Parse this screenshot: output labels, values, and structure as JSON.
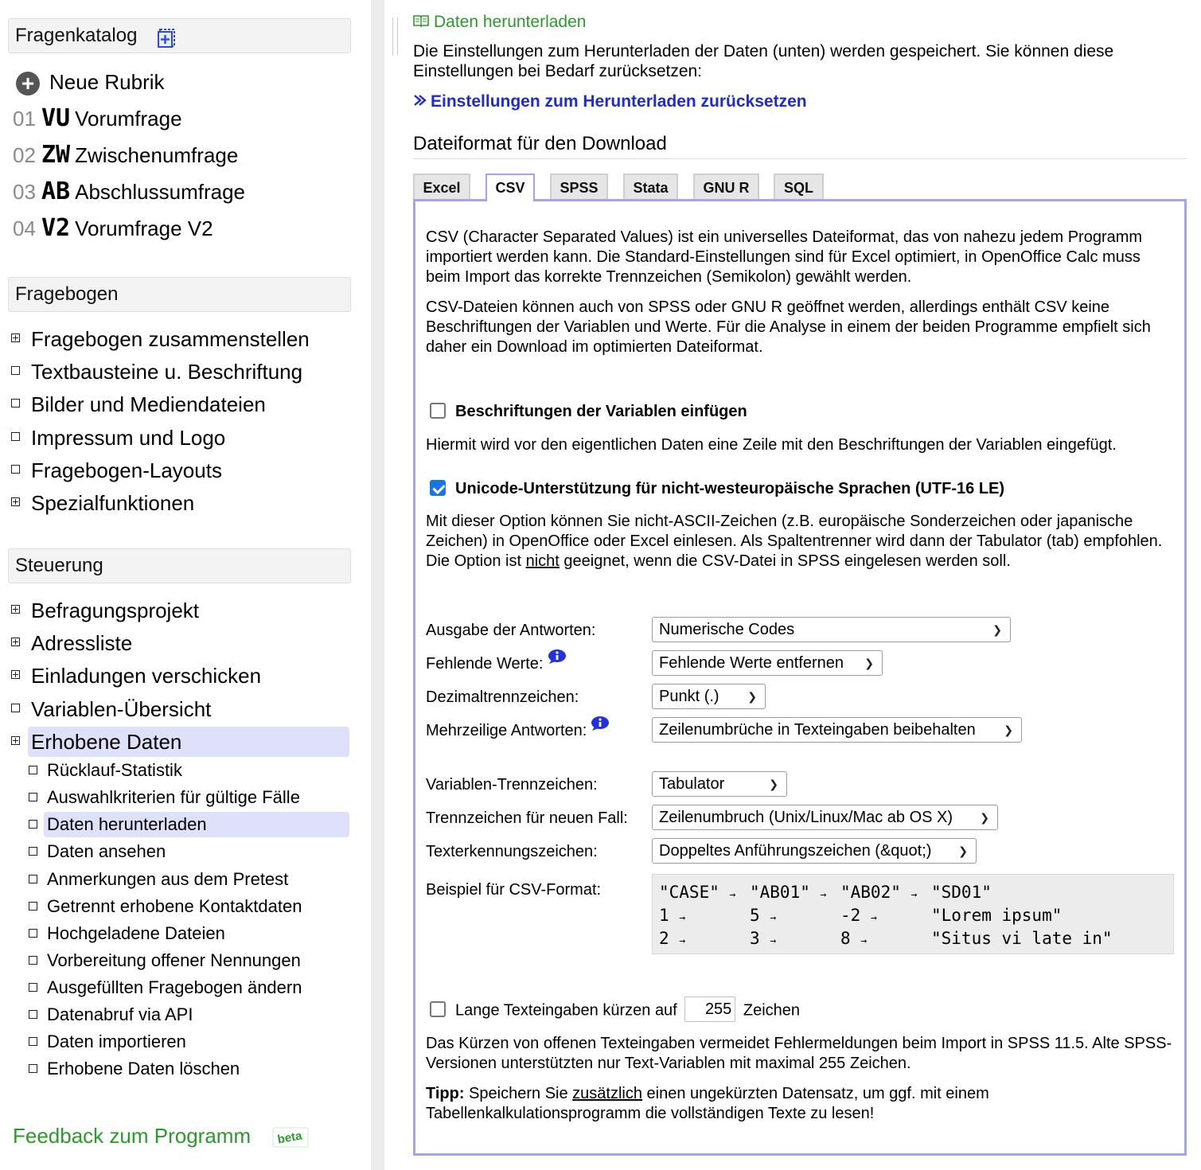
{
  "sidebar": {
    "catalog_title": "Fragenkatalog",
    "new_section": "Neue Rubrik",
    "sections": [
      {
        "num": "01",
        "code": "VU",
        "name": "Vorumfrage"
      },
      {
        "num": "02",
        "code": "ZW",
        "name": "Zwischenumfrage"
      },
      {
        "num": "03",
        "code": "AB",
        "name": "Abschlussumfrage"
      },
      {
        "num": "04",
        "code": "V2",
        "name": "Vorumfrage V2"
      }
    ],
    "questionnaire_title": "Fragebogen",
    "questionnaire_items": [
      "Fragebogen zusammenstellen",
      "Textbausteine u. Beschriftung",
      "Bilder und Mediendateien",
      "Impressum und Logo",
      "Fragebogen-Layouts",
      "Spezialfunktionen"
    ],
    "control_title": "Steuerung",
    "control_items": [
      "Befragungsprojekt",
      "Adressliste",
      "Einladungen verschicken",
      "Variablen-Übersicht",
      "Erhobene Daten"
    ],
    "data_items": [
      "Rücklauf-Statistik",
      "Auswahlkriterien für gültige Fälle",
      "Daten herunterladen",
      "Daten ansehen",
      "Anmerkungen aus dem Pretest",
      "Getrennt erhobene Kontaktdaten",
      "Hochgeladene Dateien",
      "Vorbereitung offener Nennungen",
      "Ausgefüllten Fragebogen ändern",
      "Datenabruf via API",
      "Daten importieren",
      "Erhobene Daten löschen"
    ],
    "feedback": "Feedback zum Programm",
    "beta": "beta"
  },
  "main": {
    "breadcrumb": "Daten herunterladen",
    "intro": "Die Einstellungen zum Herunterladen der Daten (unten) werden gespeichert. Sie können diese Einstellungen bei Bedarf zurücksetzen:",
    "reset_link": "Einstellungen zum Herunterladen zurücksetzen",
    "format_title": "Dateiformat für den Download",
    "tabs": [
      "Excel",
      "CSV",
      "SPSS",
      "Stata",
      "GNU R",
      "SQL"
    ],
    "active_tab": "CSV",
    "csv_desc_1": "CSV (Character Separated Values) ist ein universelles Dateiformat, das von nahezu jedem Programm importiert werden kann. Die Standard-Einstellungen sind für Excel optimiert, in OpenOffice Calc muss beim Import das korrekte Trennzeichen (Semikolon) gewählt werden.",
    "csv_desc_2": "CSV-Dateien können auch von SPSS oder GNU R geöffnet werden, allerdings enthält CSV keine Beschriftungen der Variablen und Werte. Für die Analyse in einem der beiden Programme empfielt sich daher ein Download im optimierten Dateiformat.",
    "opt_labels": {
      "label": "Beschriftungen der Variablen einfügen",
      "checked": false,
      "help": "Hiermit wird vor den eigentlichen Daten eine Zeile mit den Beschriftungen der Variablen eingefügt."
    },
    "opt_unicode": {
      "label": "Unicode-Unterstützung für nicht-westeuropäische Sprachen (UTF-16 LE)",
      "checked": true,
      "help_a": "Mit dieser Option können Sie nicht-ASCII-Zeichen (z.B. europäische Sonderzeichen oder japanische Zeichen) in OpenOffice oder Excel einlesen. Als Spaltentrenner wird dann der Tabulator (tab) empfohlen. Die Option ist ",
      "help_em": "nicht",
      "help_b": " geeignet, wenn die CSV-Datei in SPSS eingelesen werden soll."
    },
    "fields": {
      "answers_label": "Ausgabe der Antworten:",
      "answers_value": "Numerische Codes",
      "missing_label": "Fehlende Werte:",
      "missing_value": "Fehlende Werte entfernen",
      "decimal_label": "Dezimaltrennzeichen:",
      "decimal_value": "Punkt (.)",
      "multiline_label": "Mehrzeilige Antworten:",
      "multiline_value": "Zeilenumbrüche in Texteingaben beibehalten",
      "varsep_label": "Variablen-Trennzeichen:",
      "varsep_value": "Tabulator",
      "casesep_label": "Trennzeichen für neuen Fall:",
      "casesep_value": "Zeilenumbruch (Unix/Linux/Mac ab OS X)",
      "quote_label": "Texterkennungszeichen:",
      "quote_value": "Doppeltes Anführungszeichen (&quot;)",
      "example_label": "Beispiel für CSV-Format:"
    },
    "example_rows": [
      [
        "\"CASE\"",
        "\"AB01\"",
        "\"AB02\"",
        "\"SD01\""
      ],
      [
        "1",
        "5",
        "-2",
        "\"Lorem ipsum\""
      ],
      [
        "2",
        "3",
        "8",
        "\"Situs vi late in\""
      ]
    ],
    "tab_arrow": "→",
    "truncate": {
      "checked": false,
      "label_before": "Lange Texteingaben kürzen auf",
      "value": "255",
      "label_after": "Zeichen",
      "help": "Das Kürzen von offenen Texteingaben vermeidet Fehlermeldungen beim Import in SPSS 11.5. Alte SPSS-Versionen unterstützten nur Text-Variablen mit maximal 255 Zeichen.",
      "tip_bold": "Tipp:",
      "tip_a": " Speichern Sie ",
      "tip_em": "zusätzlich",
      "tip_b": " einen ungekürzten Datensatz, um ggf. mit einem Tabellenkalkulationsprogramm die vollständigen Texte zu lesen!"
    }
  },
  "colors": {
    "accent_green": "#2a9a2a",
    "link_blue": "#1d2bd0",
    "active_highlight": "#dfe1fb",
    "panel_border": "#a3a3f0"
  }
}
